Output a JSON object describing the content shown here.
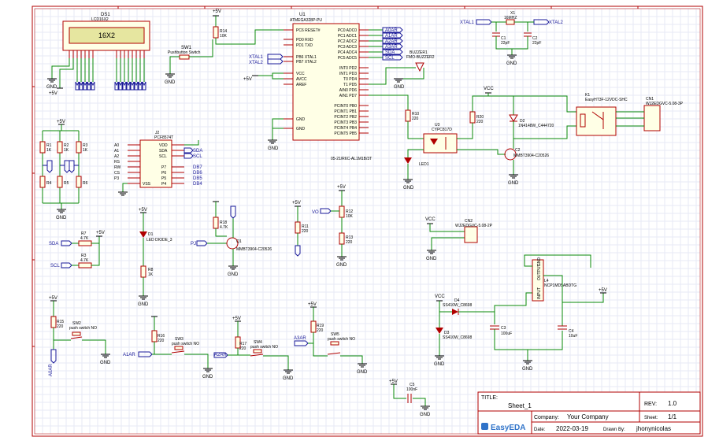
{
  "labels": {
    "ds1_ref": "DS1",
    "ds1_val": "LCD16X2",
    "lcd_text": "16X2",
    "u1_ref": "U1",
    "u1_val": "ATMEGA328P-PU",
    "u1_l0": "PC6 RESET#",
    "u1_l1": "PD0 RXD",
    "u1_l2": "PD1 TXD",
    "u1_l3": "PB6 XTAL1",
    "u1_l4": "PB7 XTAL2",
    "u1_l5": "VCC",
    "u1_l6": "AVCC",
    "u1_l7": "AREF",
    "u1_l8": "GND",
    "u1_l9": "GND",
    "u1_r0": "PC0 ADC0",
    "u1_r1": "PC1 ADC1",
    "u1_r2": "PC2 ADC2",
    "u1_r3": "PC3 ADC3",
    "u1_r4": "PC4 ADC4",
    "u1_r5": "PC5 ADC5",
    "u1_r6": "INT0 PD2",
    "u1_r7": "INT1 PD3",
    "u1_r8": "T0 PD4",
    "u1_r9": "T1 PD5",
    "u1_r10": "AIN0 PD6",
    "u1_r11": "AIN1 PD7",
    "u1_r12": "PCINT0 PB0",
    "u1_r13": "PCINT1 PB1",
    "u1_r14": "PCINT2 PB2",
    "u1_r15": "PCINT3 PB3",
    "u1_r16": "PCINT4 PB4",
    "u1_r17": "PCINT5 PB5",
    "net_a0ar": "A0AR",
    "net_a1ar": "A1AR",
    "net_a2ar": "A2AR",
    "net_a3ar": "A3AR",
    "net_sda": "SDA",
    "net_scl": "SCL",
    "net_xtal1": "XTAL1",
    "net_xtal2": "XTAL2",
    "net_vo": "VO",
    "net_pj": "PJ",
    "x1_ref": "X1",
    "x1_val": "16MHZ",
    "c1_ref": "C1",
    "c1_val": "22pF",
    "c2_ref": "C2",
    "c2_val": "22pF",
    "sw1_ref": "SW1",
    "sw1_val": "Pushbutton Switch",
    "r14_ref": "R14",
    "r14_val": "10K",
    "buzzer_ref": "BUZZER1",
    "buzzer_val": "FMO-BUZZER2",
    "k1_ref": "K1",
    "k1_val": "EasyHT3F-12VDC-SHC",
    "cn1_ref": "CN1",
    "cn1_val": "WJ2EDGVC-5.08-3P",
    "r10_ref": "R10",
    "r10_val": "220",
    "r20_ref": "R20",
    "r20_val": "220",
    "u3_ref": "U3",
    "u3_val": "CYPC817D",
    "d2_ref": "D2",
    "d2_val": "1N4148W_C444720",
    "led1_ref": "LED1",
    "led1_val": "05-21/R6C-AL1M1B/3T",
    "q2_ref": "C2",
    "q2_val": "MMBT3904-C20526",
    "j2_ref": "J2",
    "j2_val": "PCF8574T",
    "j2_l0": "A0",
    "j2_l1": "A1",
    "j2_l2": "A2",
    "j2_l3": "RS",
    "j2_l4": "RW",
    "j2_l5": "CS",
    "j2_l6": "P3",
    "j2_l7": "VSS",
    "j2_r0": "VDD",
    "j2_r1": "SDA",
    "j2_r2": "SCL",
    "j2_r3": "P7",
    "j2_r4": "P6",
    "j2_r5": "P5",
    "j2_r6": "P4",
    "db7": "DB7",
    "db6": "DB6",
    "db5": "DB5",
    "db4": "DB4",
    "r1_ref": "R1",
    "r1_val": "1K",
    "r2_ref": "R2",
    "r2_val": "1K",
    "r3s_ref": "R3",
    "r3s_val": "1K",
    "r4_ref": "R4",
    "r5_ref": "R5",
    "r6_ref": "R6",
    "r7_ref": "R7",
    "r7_val": "4.7K",
    "r3_ref": "R3",
    "r3_val": "4.7K",
    "d1_ref": "D1",
    "d1_val": "LED DIODE_3",
    "r8_ref": "R8",
    "r8_val": "1K",
    "r18_ref": "R18",
    "r18_val": "4.7K",
    "q1_ref": "Q1",
    "q1_val": "MMBT3904-C20526",
    "r11_ref": "R11",
    "r11_val": "220",
    "r12_ref": "R12",
    "r12_val": "10K",
    "r13_ref": "R13",
    "r13_val": "220",
    "cn2_ref": "CN2",
    "cn2_val": "WJ2EDGVC-5.08-2P",
    "l4_ref": "L4",
    "l4_val": "NCP1MD5ABDTG",
    "l4_in": "INPUT",
    "l4_out": "OUTPUT",
    "l4_gnd": "GND",
    "d4_ref": "D4",
    "d4_val": "SS410W_C8698",
    "d3_ref": "D3",
    "d3_val": "SS410W_C8698",
    "c3_ref": "C3",
    "c3_val": "100uF",
    "c4_ref": "C4",
    "c4_val": "10uF",
    "r15_ref": "R15",
    "r15_val": "220",
    "sw2_ref": "SW2",
    "sw2_val": "push switch NO",
    "r16_ref": "R16",
    "r16_val": "220",
    "sw3_ref": "SW3",
    "sw3_val": "push switch NO",
    "r17_ref": "R17",
    "r17_val": "220",
    "sw4_ref": "SW4",
    "sw4_val": "push switch NO",
    "r19_ref": "R19",
    "r19_val": "220",
    "sw5_ref": "SW5",
    "sw5_val": "push switch NO",
    "c5_ref": "C5",
    "c5_val": "100nF",
    "pwr_5v": "+5V",
    "pwr_gnd": "GND",
    "pwr_vcc": "VCC"
  },
  "titleblock": {
    "title_label": "TITLE:",
    "title": "Sheet_1",
    "rev_label": "REV:",
    "rev": "1.0",
    "company_label": "Company:",
    "company": "Your Company",
    "sheet_label": "Sheet:",
    "sheet": "1/1",
    "date_label": "Date:",
    "date": "2022-03-19",
    "drawn_label": "Drawn By:",
    "drawn": "jhonynicolas",
    "brand": "EasyEDA"
  },
  "colors": {
    "wire": "#0a8a0a",
    "part": "#b00000",
    "net": "#1a1a99",
    "body_fill": "#ffffe6",
    "grid": "#e7eaf6"
  }
}
